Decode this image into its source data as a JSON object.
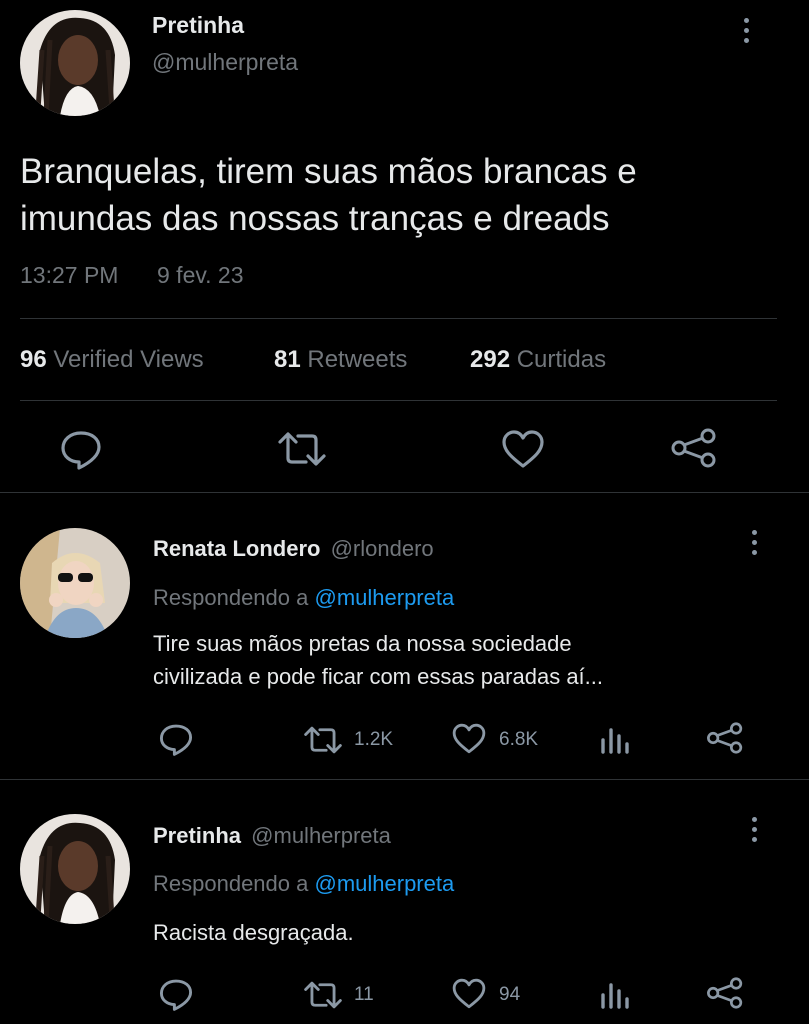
{
  "main_tweet": {
    "author_name": "Pretinha",
    "author_handle": "@mulherpreta",
    "text_line1": "Branquelas, tirem suas mãos brancas e",
    "text_line2": "imundas das nossas tranças e dreads",
    "time": "13:27 PM",
    "date": "9 fev. 23",
    "stats": {
      "views_count": "96",
      "views_label": "Verified Views",
      "retweets_count": "81",
      "retweets_label": "Retweets",
      "likes_count": "292",
      "likes_label": "Curtidas"
    },
    "actions": [
      "reply-icon",
      "retweet-icon",
      "like-icon",
      "share-icon"
    ]
  },
  "replies": [
    {
      "author_name": "Renata Londero",
      "author_handle": "@rlondero",
      "replying_prefix": "Respondendo a",
      "replying_handle": "@mulherpreta",
      "text_line1": "Tire suas mãos pretas da nossa sociedade",
      "text_line2": "civilizada e pode ficar com essas paradas aí...",
      "retweets": "1.2K",
      "likes": "6.8K"
    },
    {
      "author_name": "Pretinha",
      "author_handle": "@mulherpreta",
      "replying_prefix": "Respondendo a",
      "replying_handle": "@mulherpreta",
      "text_line1": "Racista desgraçada.",
      "retweets": "11",
      "likes": "94"
    }
  ],
  "colors": {
    "background": "#000000",
    "text": "#e7e9ea",
    "muted": "#71767b",
    "link": "#1d9bf0",
    "divider": "#2f3336"
  }
}
